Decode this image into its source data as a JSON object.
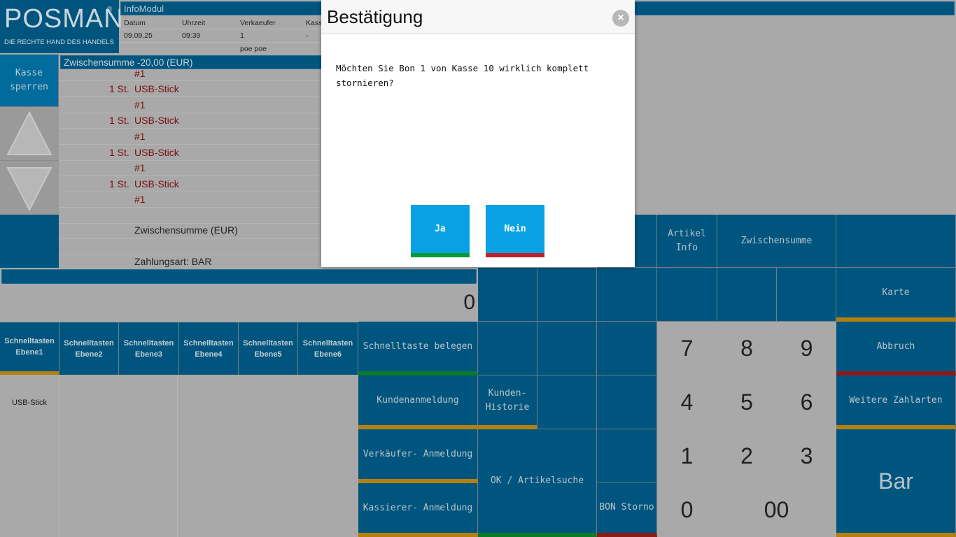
{
  "logo": {
    "brand": "POSMAN",
    "reg": "®",
    "tagline": "DIE RECHTE HAND DES HANDELS"
  },
  "infomodul": {
    "title": "InfoModul",
    "headers": [
      "Datum",
      "Uhrzeit",
      "Verkaeufer",
      "Kass"
    ],
    "values": [
      "09.09.25",
      "09:39",
      "1",
      "-"
    ],
    "seller_name": "poe poe"
  },
  "subtotal_header": "Zwischensumme -20,00 (EUR)",
  "sidebar": {
    "lock_label": "Kasse\nsperren"
  },
  "receipt": {
    "lines": [
      {
        "qty": "",
        "text": "#1"
      },
      {
        "qty": "1 St.",
        "text": "USB-Stick"
      },
      {
        "qty": "",
        "text": "#1"
      },
      {
        "qty": "1 St.",
        "text": "USB-Stick"
      },
      {
        "qty": "",
        "text": "#1"
      },
      {
        "qty": "1 St.",
        "text": "USB-Stick"
      },
      {
        "qty": "",
        "text": "#1"
      },
      {
        "qty": "1 St.",
        "text": "USB-Stick"
      },
      {
        "qty": "",
        "text": "#1"
      }
    ],
    "subtotal_label": "Zwischensumme (EUR)",
    "payment_label": "Zahlungsart: BAR"
  },
  "input": {
    "display_value": "0"
  },
  "layers": [
    "Schnelltasten\nEbene1",
    "Schnelltasten\nEbene2",
    "Schnelltasten\nEbene3",
    "Schnelltasten\nEbene4",
    "Schnelltasten\nEbene5",
    "Schnelltasten\nEbene6"
  ],
  "quick_items": {
    "item1": "USB-Stick"
  },
  "buttons": {
    "artikel_info": "Artikel\nInfo",
    "zwischensumme": "Zwischensumme",
    "karte": "Karte",
    "schnelltaste_belegen": "Schnelltaste belegen",
    "abbruch": "Abbruch",
    "kundenanmeldung": "Kundenanmeldung",
    "kunden_historie": "Kunden-\nHistorie",
    "weitere_zahlarten": "Weitere Zahlarten",
    "verkaeufer_anmeldung": "Verkäufer- Anmeldung",
    "ok_artikelsuche": "OK / Artikelsuche",
    "kassierer_anmeldung": "Kassierer- Anmeldung",
    "bon_storno": "BON Storno",
    "bar": "Bar"
  },
  "numpad": {
    "k7": "7",
    "k8": "8",
    "k9": "9",
    "k4": "4",
    "k5": "5",
    "k6": "6",
    "k1": "1",
    "k2": "2",
    "k3": "3",
    "k0": "0",
    "k00": "00"
  },
  "dialog": {
    "title": "Bestätigung",
    "close": "×",
    "message": "Möchten Sie Bon 1 von Kasse 10 wirklich komplett stornieren?",
    "yes": "Ja",
    "no": "Nein"
  },
  "colors": {
    "tile": "#00557f",
    "dialog_button": "#08a2e4",
    "green": "#0a9a3a",
    "red": "#c0202a",
    "orange": "#b3800e"
  }
}
